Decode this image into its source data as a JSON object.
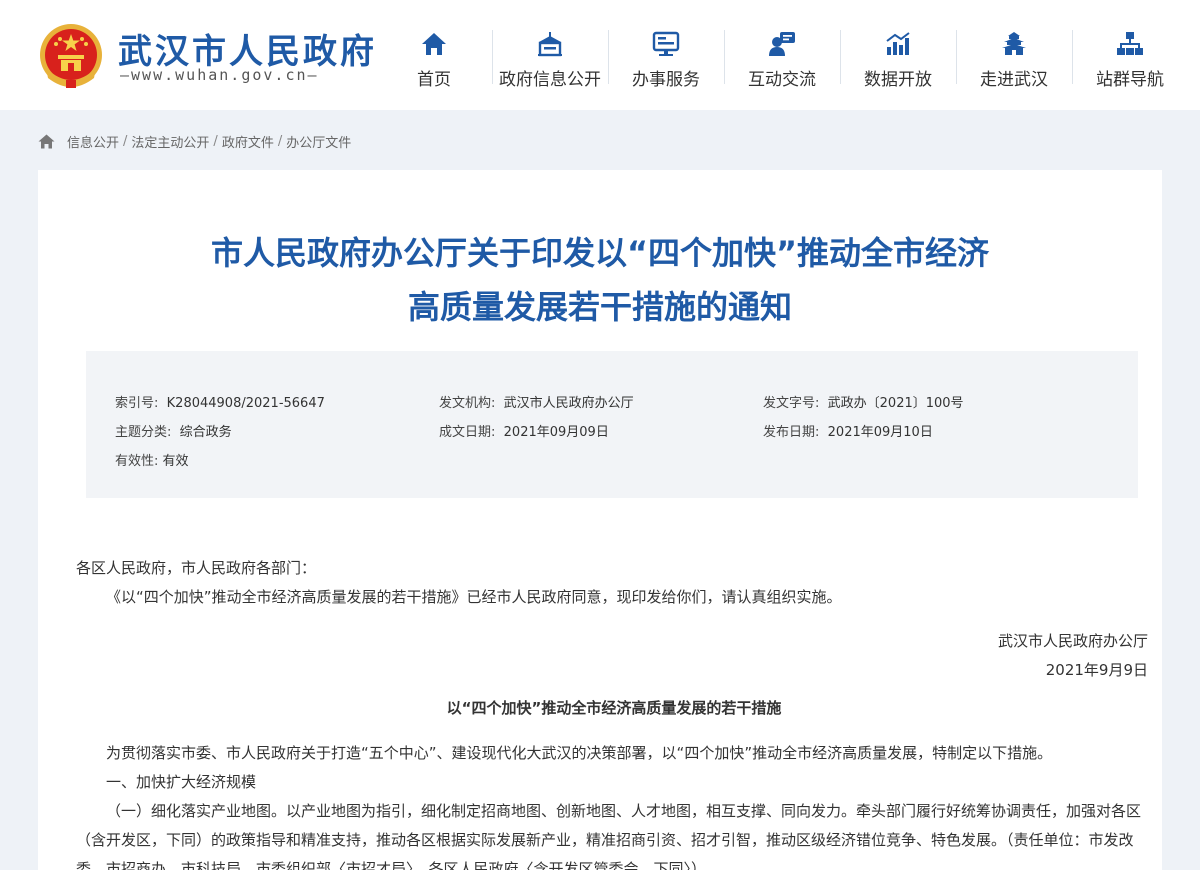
{
  "header": {
    "site_name": "武汉市人民政府",
    "site_url": "—www.wuhan.gov.cn—",
    "nav": [
      {
        "label": "首页",
        "icon": "home-icon"
      },
      {
        "label": "政府信息公开",
        "icon": "building-icon"
      },
      {
        "label": "办事服务",
        "icon": "service-screen-icon"
      },
      {
        "label": "互动交流",
        "icon": "chat-user-icon"
      },
      {
        "label": "数据开放",
        "icon": "bar-chart-icon"
      },
      {
        "label": "走进武汉",
        "icon": "tower-icon"
      },
      {
        "label": "站群导航",
        "icon": "sitemap-icon"
      }
    ]
  },
  "breadcrumb": [
    "信息公开",
    "法定主动公开",
    "政府文件",
    "办公厅文件"
  ],
  "document": {
    "title_line1": "市人民政府办公厅关于印发以“四个加快”推动全市经济",
    "title_line2": "高质量发展若干措施的通知",
    "meta": {
      "index_no_label": "索引号:",
      "index_no": "K28044908/2021-56647",
      "issuer_label": "发文机构:",
      "issuer": "武汉市人民政府办公厅",
      "doc_no_label": "发文字号:",
      "doc_no": "武政办〔2021〕100号",
      "topic_label": "主题分类:",
      "topic": "综合政务",
      "written_date_label": "成文日期:",
      "written_date": "2021年09月09日",
      "publish_date_label": "发布日期:",
      "publish_date": "2021年09月10日",
      "validity_label": "有效性:",
      "validity": "有效"
    },
    "salutation": "各区人民政府，市人民政府各部门：",
    "intro": "《以“四个加快”推动全市经济高质量发展的若干措施》已经市人民政府同意，现印发给你们，请认真组织实施。",
    "signature_org": "武汉市人民政府办公厅",
    "signature_date": "2021年9月9日",
    "measures_title": "以“四个加快”推动全市经济高质量发展的若干措施",
    "preamble": "为贯彻落实市委、市人民政府关于打造“五个中心”、建设现代化大武汉的决策部署，以“四个加快”推动全市经济高质量发展，特制定以下措施。",
    "section1": "一、加快扩大经济规模",
    "item1": "（一）细化落实产业地图。以产业地图为指引，细化制定招商地图、创新地图、人才地图，相互支撑、同向发力。牵头部门履行好统筹协调责任，加强对各区（含开发区，下同）的政策指导和精准支持，推动各区根据实际发展新产业，精准招商引资、招才引智，推动区级经济错位竞争、特色发展。（责任单位：市发改委、市招商办、市科技局，市委组织部〈市招才局〉，各区人民政府〈含开发区管委会，下同〉）"
  },
  "colors": {
    "brand_blue": "#1f5aa6",
    "page_bg": "#eef2f7",
    "meta_bg": "#f2f4f7"
  }
}
